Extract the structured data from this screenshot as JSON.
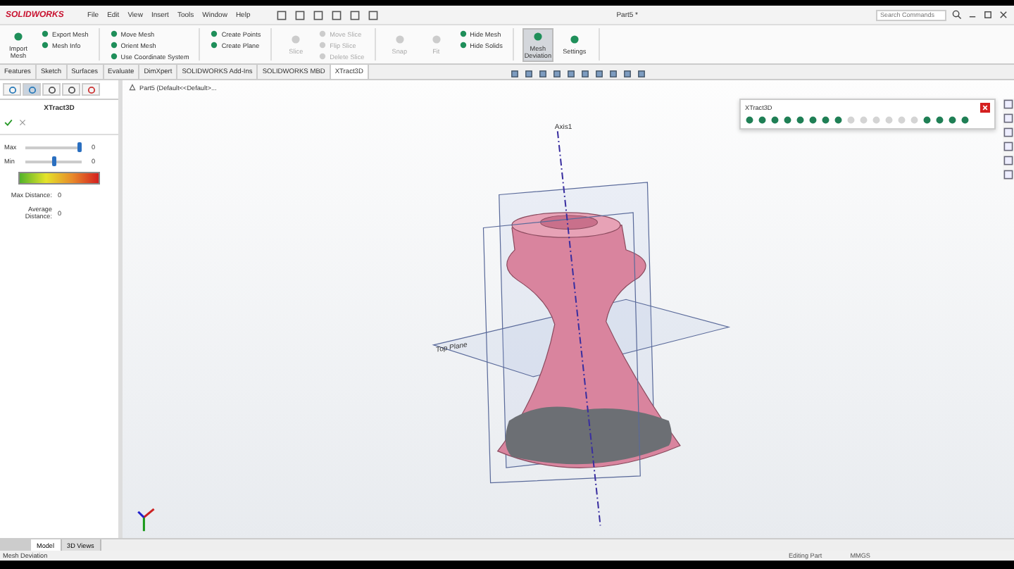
{
  "app": {
    "logo": "SOLIDWORKS",
    "menu": [
      "File",
      "Edit",
      "View",
      "Insert",
      "Tools",
      "Window",
      "Help"
    ],
    "document_title": "Part5 *",
    "search": {
      "placeholder": "Search Commands"
    }
  },
  "ribbon": {
    "groups": [
      {
        "items": [
          {
            "label": "Import Mesh",
            "kind": "large",
            "disabled": false,
            "selected": false
          },
          {
            "label": "Export Mesh",
            "kind": "small",
            "disabled": false,
            "selected": false
          },
          {
            "label": "Mesh Info",
            "kind": "small",
            "disabled": false,
            "selected": false
          }
        ]
      },
      {
        "items": [
          {
            "label": "Move Mesh",
            "kind": "small",
            "disabled": false,
            "selected": false
          },
          {
            "label": "Orient Mesh",
            "kind": "small",
            "disabled": false,
            "selected": false
          },
          {
            "label": "Use Coordinate System",
            "kind": "small",
            "disabled": false,
            "selected": false
          }
        ]
      },
      {
        "items": [
          {
            "label": "Create Points",
            "kind": "small",
            "disabled": false,
            "selected": false
          },
          {
            "label": "Create Plane",
            "kind": "small",
            "disabled": false,
            "selected": false
          }
        ]
      },
      {
        "items": [
          {
            "label": "Slice",
            "kind": "large",
            "disabled": true,
            "selected": false
          },
          {
            "label": "Move Slice",
            "kind": "small",
            "disabled": true,
            "selected": false
          },
          {
            "label": "Flip Slice",
            "kind": "small",
            "disabled": true,
            "selected": false
          },
          {
            "label": "Delete Slice",
            "kind": "small",
            "disabled": true,
            "selected": false
          }
        ]
      },
      {
        "items": [
          {
            "label": "Snap",
            "kind": "large",
            "disabled": true,
            "selected": false
          },
          {
            "label": "Fit",
            "kind": "large",
            "disabled": true,
            "selected": false
          },
          {
            "label": "Hide Mesh",
            "kind": "small",
            "disabled": false,
            "selected": false
          },
          {
            "label": "Hide Solids",
            "kind": "small",
            "disabled": false,
            "selected": false
          }
        ]
      },
      {
        "items": [
          {
            "label": "Mesh Deviation",
            "kind": "large",
            "disabled": false,
            "selected": true
          },
          {
            "label": "Settings",
            "kind": "large",
            "disabled": false,
            "selected": false
          }
        ]
      }
    ]
  },
  "tabs": [
    {
      "label": "Features",
      "selected": false
    },
    {
      "label": "Sketch",
      "selected": false
    },
    {
      "label": "Surfaces",
      "selected": false
    },
    {
      "label": "Evaluate",
      "selected": false
    },
    {
      "label": "DimXpert",
      "selected": false
    },
    {
      "label": "SOLIDWORKS Add-Ins",
      "selected": false
    },
    {
      "label": "SOLIDWORKS MBD",
      "selected": false
    },
    {
      "label": "XTract3D",
      "selected": true
    }
  ],
  "property_manager": {
    "tabs": [
      {
        "selected": false
      },
      {
        "selected": true
      },
      {
        "selected": false
      },
      {
        "selected": false
      },
      {
        "selected": false
      }
    ],
    "title": "XTract3D",
    "sliders": [
      {
        "label": "Max",
        "level": 0.95,
        "reading": "0"
      },
      {
        "label": "Min",
        "level": 0.5,
        "reading": "0"
      }
    ],
    "stats": [
      {
        "label": "Max Distance:",
        "value": "0"
      },
      {
        "label": "Average Distance:",
        "value": "0"
      }
    ]
  },
  "tree": {
    "root": "Part5 (Default<<Default>..."
  },
  "floating_toolbar": {
    "title": "XTract3D",
    "tools": [
      {
        "disabled": false
      },
      {
        "disabled": false
      },
      {
        "disabled": false
      },
      {
        "disabled": false
      },
      {
        "disabled": false
      },
      {
        "disabled": false
      },
      {
        "disabled": false
      },
      {
        "disabled": false
      },
      {
        "disabled": true
      },
      {
        "disabled": true
      },
      {
        "disabled": true
      },
      {
        "disabled": true
      },
      {
        "disabled": true
      },
      {
        "disabled": true
      },
      {
        "disabled": false
      },
      {
        "disabled": false
      },
      {
        "disabled": false
      },
      {
        "disabled": false
      }
    ]
  },
  "viewport": {
    "axis_label": "Axis1",
    "plane_label": "Top Plane"
  },
  "bottom_tabs": [
    {
      "label": "Model",
      "selected": true
    },
    {
      "label": "3D Views",
      "selected": false
    }
  ],
  "status_bar": {
    "message": "Mesh Deviation",
    "mode": "Editing Part",
    "units": "MMGS"
  }
}
